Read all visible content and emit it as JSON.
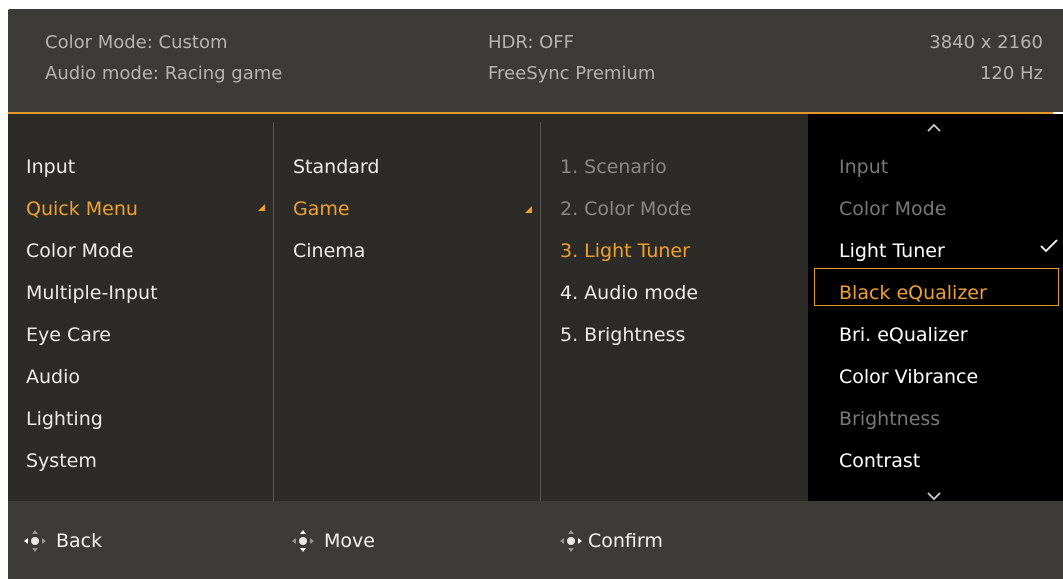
{
  "header": {
    "color_mode": "Color Mode: Custom",
    "audio_mode": "Audio mode: Racing game",
    "hdr": "HDR: OFF",
    "freesync": "FreeSync Premium",
    "resolution": "3840 x 2160",
    "refresh": "120 Hz"
  },
  "main_menu": {
    "items": [
      "Input",
      "Quick Menu",
      "Color Mode",
      "Multiple-Input",
      "Eye Care",
      "Audio",
      "Lighting",
      "System"
    ],
    "selected": "Quick Menu"
  },
  "sub_menu": {
    "items": [
      "Standard",
      "Game",
      "Cinema"
    ],
    "selected": "Game"
  },
  "slot_menu": {
    "items": [
      "1. Scenario",
      "2. Color Mode",
      "3. Light Tuner",
      "4. Audio mode",
      "5. Brightness"
    ],
    "selected": "3. Light Tuner",
    "disabled": [
      "1. Scenario",
      "2. Color Mode"
    ]
  },
  "option_list": {
    "items": [
      "Input",
      "Color Mode",
      "Light Tuner",
      "Black eQualizer",
      "Bri. eQualizer",
      "Color Vibrance",
      "Brightness",
      "Contrast"
    ],
    "checked": "Light Tuner",
    "focused": "Black eQualizer",
    "disabled": [
      "Input",
      "Color Mode",
      "Brightness"
    ],
    "scroll_up_icon": "chevron-up-icon",
    "scroll_down_icon": "chevron-down-icon",
    "check_icon": "checkmark-icon"
  },
  "footer": {
    "back": "Back",
    "move": "Move",
    "confirm": "Confirm",
    "joystick_icon": "five-way-joystick-icon"
  },
  "colors": {
    "accent": "#f0a030",
    "header_bg": "#3d3b38",
    "body_bg": "#2d2b28",
    "list_bg": "#000000"
  }
}
